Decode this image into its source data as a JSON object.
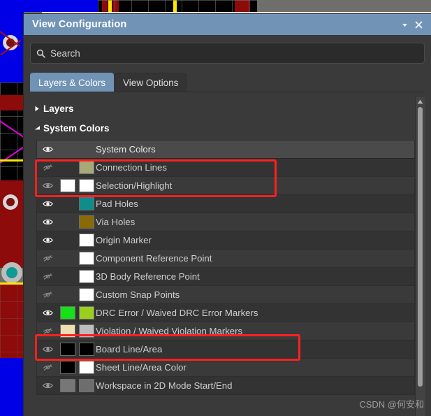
{
  "window": {
    "title": "View Configuration",
    "menu_icon": "chevron-down-icon",
    "close_icon": "close-icon"
  },
  "search": {
    "placeholder": "Search",
    "value": "",
    "icon": "search-icon"
  },
  "tabs": [
    {
      "label": "Layers & Colors",
      "active": true
    },
    {
      "label": "View Options",
      "active": false
    }
  ],
  "groups": [
    {
      "name": "Layers",
      "expanded": false,
      "triangle": "triangle-right-icon"
    },
    {
      "name": "System Colors",
      "expanded": true,
      "triangle": "triangle-down-icon"
    }
  ],
  "list": {
    "header": {
      "label": "System Colors",
      "visible": true,
      "eye": "eye-open-icon"
    },
    "rows": [
      {
        "label": "Connection Lines",
        "eye": "eye-closed-icon",
        "visible": false,
        "swatches": [
          "#a8a879"
        ]
      },
      {
        "label": "Selection/Highlight",
        "eye": "eye-open-dim-icon",
        "visible": true,
        "swatches": [
          "#ffffff",
          "#ffffff"
        ]
      },
      {
        "label": "Pad Holes",
        "eye": "eye-open-icon",
        "visible": true,
        "swatches": [
          "#0f8c8c"
        ]
      },
      {
        "label": "Via Holes",
        "eye": "eye-open-icon",
        "visible": true,
        "swatches": [
          "#8a6a06"
        ]
      },
      {
        "label": "Origin Marker",
        "eye": "eye-open-icon",
        "visible": true,
        "swatches": [
          "#ffffff"
        ]
      },
      {
        "label": "Component Reference Point",
        "eye": "eye-closed-icon",
        "visible": false,
        "swatches": [
          "#ffffff"
        ]
      },
      {
        "label": "3D Body Reference Point",
        "eye": "eye-closed-icon",
        "visible": false,
        "swatches": [
          "#ffffff"
        ]
      },
      {
        "label": "Custom Snap Points",
        "eye": "eye-closed-icon",
        "visible": false,
        "swatches": [
          "#ffffff"
        ]
      },
      {
        "label": "DRC Error / Waived DRC Error Markers",
        "eye": "eye-open-icon",
        "visible": true,
        "swatches": [
          "#16e016",
          "#9bcf1f"
        ]
      },
      {
        "label": "Violation / Waived Violation Markers",
        "eye": "eye-closed-icon",
        "visible": false,
        "swatches": [
          "#f0ddb0",
          "#bdbdbd"
        ]
      },
      {
        "label": "Board Line/Area",
        "eye": "eye-open-dim-icon",
        "visible": true,
        "swatches": [
          "#000000",
          "#000000"
        ]
      },
      {
        "label": "Sheet Line/Area Color",
        "eye": "eye-closed-icon",
        "visible": false,
        "swatches": [
          "#000000",
          "#ffffff"
        ]
      },
      {
        "label": "Workspace in 2D Mode Start/End",
        "eye": "eye-open-dim-icon",
        "visible": true,
        "swatches": [
          "#777777",
          "#6e6e6e"
        ]
      }
    ]
  },
  "annotations": [
    {
      "name": "highlight-connection-lines",
      "target": "Connection Lines + System Colors header"
    },
    {
      "name": "highlight-violation-markers",
      "target": "Violation / Waived Violation Markers"
    }
  ],
  "scrollbar": {
    "up_arrow": "triangle-up-icon"
  },
  "watermark": "CSDN @何安和",
  "colors": {
    "titlebar": "#7193b6",
    "dialog_bg": "#3a3a3a",
    "list_bg": "#333333",
    "row_header_bg": "#4a4a4a",
    "annotation_red": "#ff2020",
    "text": "#cfcfcf"
  }
}
